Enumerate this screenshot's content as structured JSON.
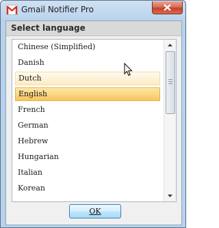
{
  "window": {
    "title": "Gmail Notifier Pro"
  },
  "dialog": {
    "header": "Select language",
    "languages": [
      "Chinese (Simplified)",
      "Danish",
      "Dutch",
      "English",
      "French",
      "German",
      "Hebrew",
      "Hungarian",
      "Italian",
      "Korean"
    ],
    "hovered": "Dutch",
    "selected": "English",
    "ok_label": "OK"
  },
  "icons": {
    "app": "gmail-icon",
    "close": "close-icon",
    "scroll_up": "chevron-up-icon",
    "scroll_down": "chevron-down-icon",
    "cursor": "mouse-pointer-icon"
  },
  "colors": {
    "selected_bg": "#f7c65e",
    "hover_bg": "#fdecc5",
    "close_button": "#c4412a",
    "frame": "#b9d2ec"
  }
}
